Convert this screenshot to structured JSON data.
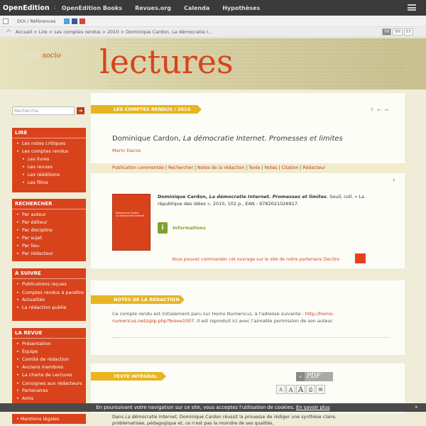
{
  "topbar": {
    "brand": "OpenEdition",
    "separator": ":",
    "nav": [
      "OpenEdition Books",
      "Revues.org",
      "Calenda",
      "Hypothèses"
    ]
  },
  "subbar": {
    "doi": "DOI / Références"
  },
  "crumbs": "Accueil > Lire > Les comptes rendus > 2010 > Dominique Cardon, La démocratie I...",
  "languages": [
    "FR",
    "EN",
    "ES"
  ],
  "header": {
    "site_prefix": "/ liens ",
    "site_highlight": "socio",
    "site_suffix": " /",
    "section_title": "lectures"
  },
  "search": {
    "placeholder": "Recherche",
    "go": "➔"
  },
  "sidebar": {
    "lire": {
      "title": "LIRE",
      "items": [
        "Les notes critiques",
        "Les comptes rendus"
      ],
      "subitems": [
        "Les livres",
        "Les revues",
        "Les rééditions",
        "Les films"
      ]
    },
    "rechercher": {
      "title": "RECHERCHER",
      "items": [
        "Par auteur",
        "Par éditeur",
        "Par discipline",
        "Par sujet",
        "Par lieu",
        "Par rédacteur"
      ]
    },
    "asuivre": {
      "title": "À SUIVRE",
      "items": [
        "Publications reçues",
        "Comptes rendus à paraître",
        "Actualités",
        "La rédaction publie"
      ]
    },
    "revue": {
      "title": "LA REVUE",
      "items": [
        "Présentation",
        "Équipe",
        "Comité de rédaction",
        "Anciens membres",
        "La charte de Lectures",
        "Consignes aux rédacteurs",
        "Partenaires",
        "Amis"
      ]
    },
    "legal": "Mentions légales"
  },
  "article": {
    "ribbon": "LES COMPTES RENDUS / 2010",
    "title_author": "Dominique Cardon, ",
    "title_book": "La démocratie Internet. Promesses et limites",
    "reviewer": "Marin Dacos",
    "links": [
      "Publication commentée",
      "Rechercher",
      "Notes de la rédaction",
      "Texte",
      "Notes",
      "Citation",
      "Rédacteur"
    ],
    "book_ref_author": "Dominique Cardon, ",
    "book_ref_title": "La démocratie Internet. Promesses et limites",
    "book_ref_rest": ", Seuil, coll. « La république des idées », 2010, 102 p., EAN : 9782021026917.",
    "book_cover_author": "Dominique Cardon",
    "book_cover_title": "La démocratie Internet",
    "informations": "Informations",
    "order_text": "Vous pouvez commander cet ouvrage sur le site de notre partenaire Decitre"
  },
  "notes": {
    "ribbon": "NOTES DE LA RÉDACTION",
    "text_before": "Ce compte rendu est initialement paru sur ",
    "text_source": "Homo Numericus",
    "text_middle": ", à l'adresse suivante : ",
    "text_link": "http://homo-numericus.net/spip.php?breve1007",
    "text_after": ". Il est reproduit ici avec l'aimable permission de son auteur."
  },
  "fulltext": {
    "ribbon": "TEXTE INTÉGRAL",
    "pdf": "PDF",
    "font_sizes": [
      "A",
      "A",
      "A"
    ],
    "body_prefix": "Dans ",
    "body_book": "La démocratie Internet",
    "body_rest": ", Dominique Cardon réussit la prouesse de rédiger une synthèse claire, problématisée, pédagogique et, ce n'est pas la moindre de ses qualités,"
  },
  "cookie": {
    "text": "En poursuivant votre navigation sur ce site, vous acceptez l'utilisation de cookies. ",
    "link": "En savoir plus",
    "close": "x"
  },
  "colors": {
    "accent": "#d8431c",
    "ribbon": "#e9b421",
    "green": "#7ea32a"
  }
}
